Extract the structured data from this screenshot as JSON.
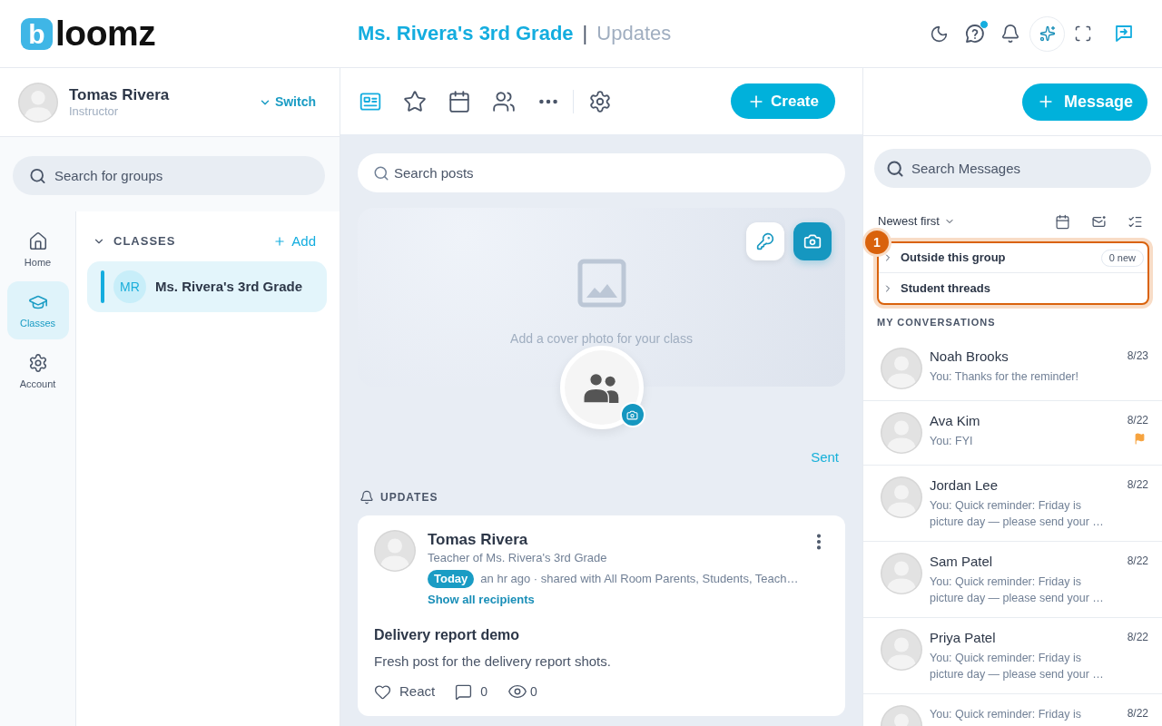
{
  "logo": {
    "mark": "b",
    "text": "loomz"
  },
  "header": {
    "group_title": "Ms. Rivera's 3rd Grade",
    "separator": "|",
    "page_title": "Updates",
    "help_badge": true
  },
  "profile": {
    "name": "Tomas Rivera",
    "role": "Instructor",
    "switch_label": "Switch"
  },
  "group_search": {
    "placeholder": "Search for groups"
  },
  "nav": [
    {
      "label": "Home",
      "selected": false
    },
    {
      "label": "Classes",
      "selected": true
    },
    {
      "label": "Account",
      "selected": false
    }
  ],
  "classes": {
    "title": "CLASSES",
    "expanded": true,
    "add_label": "Add",
    "items": [
      {
        "initials": "MR",
        "name": "Ms. Rivera's 3rd Grade",
        "selected": true
      }
    ]
  },
  "toolbar": {
    "tabs": [
      {
        "selected": true
      },
      {
        "selected": false
      },
      {
        "selected": false
      },
      {
        "selected": false
      }
    ],
    "create_label": "Create"
  },
  "post_search": {
    "placeholder": "Search posts"
  },
  "cover": {
    "hint": "Add a cover photo for your class"
  },
  "sent_link": "Sent",
  "updates_heading": "UPDATES",
  "posts": [
    {
      "author": "Tomas Rivera",
      "subtitle": "Teacher of Ms. Rivera's 3rd Grade",
      "badge": "Today",
      "meta": "an hr ago · shared with All Room Parents, Students, Teach…",
      "recipients_link": "Show all recipients",
      "title": "Delivery report demo",
      "body": "Fresh post for the delivery report shots.",
      "react_label": "React",
      "comments": "0",
      "views": "0"
    }
  ],
  "messages": {
    "new_label": "Message",
    "search": {
      "placeholder": "Search Messages"
    },
    "sort": "Newest first",
    "annotation": {
      "number": "1"
    },
    "groups": [
      {
        "label": "Outside this group",
        "expanded": false,
        "badge": "0 new"
      },
      {
        "label": "Student threads",
        "expanded": false
      }
    ],
    "section_label": "MY CONVERSATIONS",
    "conversations": [
      {
        "name": "Noah Brooks",
        "preview": "You: Thanks for the reminder!",
        "date": "8/23",
        "flagged": false
      },
      {
        "name": "Ava Kim",
        "preview": "You: FYI",
        "date": "8/22",
        "flagged": true
      },
      {
        "name": "Jordan Lee",
        "preview": "You: Quick reminder: Friday is picture day — please send your …",
        "date": "8/22",
        "flagged": false
      },
      {
        "name": "Sam Patel",
        "preview": "You: Quick reminder: Friday is picture day — please send your …",
        "date": "8/22",
        "flagged": false
      },
      {
        "name": "Priya Patel",
        "preview": "You: Quick reminder: Friday is picture day — please send your …",
        "date": "8/22",
        "flagged": false
      },
      {
        "preview": "You: Quick reminder: Friday is",
        "date": "8/22",
        "flagged": false
      }
    ]
  }
}
